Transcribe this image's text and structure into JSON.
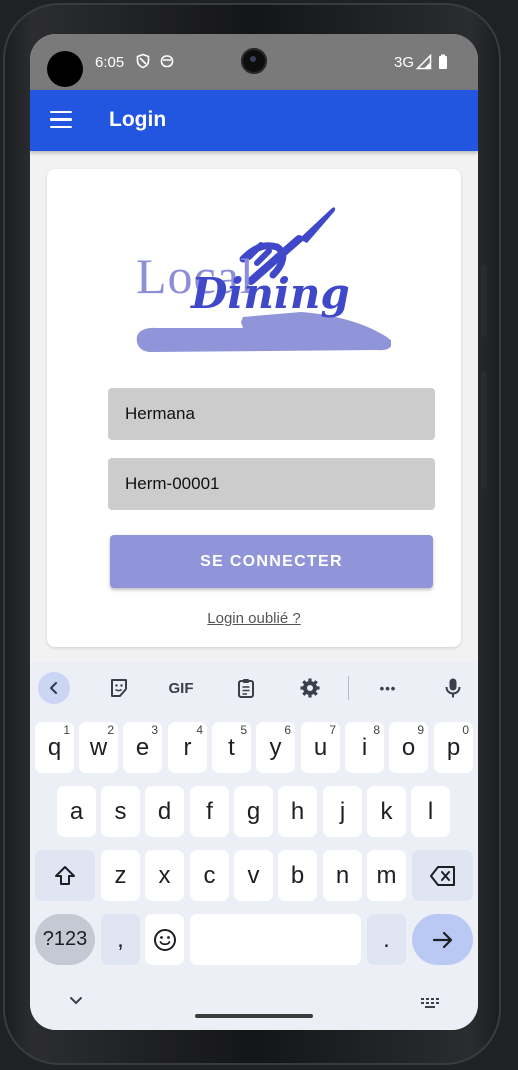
{
  "status_bar": {
    "time": "6:05",
    "network": "3G"
  },
  "app_bar": {
    "title": "Login"
  },
  "logo": {
    "text_local": "Local",
    "text_dining": "Dining"
  },
  "form": {
    "username_value": "Hermana",
    "password_value": "Herm-00001",
    "login_button_label": "SE CONNECTER",
    "forgot_link": "Login oublié ?"
  },
  "keyboard": {
    "toolbar": {
      "gif_label": "GIF",
      "more_label": "•••"
    },
    "row1": [
      {
        "key": "q",
        "hint": "1"
      },
      {
        "key": "w",
        "hint": "2"
      },
      {
        "key": "e",
        "hint": "3"
      },
      {
        "key": "r",
        "hint": "4"
      },
      {
        "key": "t",
        "hint": "5"
      },
      {
        "key": "y",
        "hint": "6"
      },
      {
        "key": "u",
        "hint": "7"
      },
      {
        "key": "i",
        "hint": "8"
      },
      {
        "key": "o",
        "hint": "9"
      },
      {
        "key": "p",
        "hint": "0"
      }
    ],
    "row2": [
      "a",
      "s",
      "d",
      "f",
      "g",
      "h",
      "j",
      "k",
      "l"
    ],
    "row3": [
      "z",
      "x",
      "c",
      "v",
      "b",
      "n",
      "m"
    ],
    "symbols_label": "?123",
    "comma_label": ",",
    "period_label": "."
  },
  "colors": {
    "app_bar": "#2255e0",
    "button": "#9094d8",
    "logo_light": "#8c8fd8",
    "logo_dark": "#3f48c8"
  }
}
